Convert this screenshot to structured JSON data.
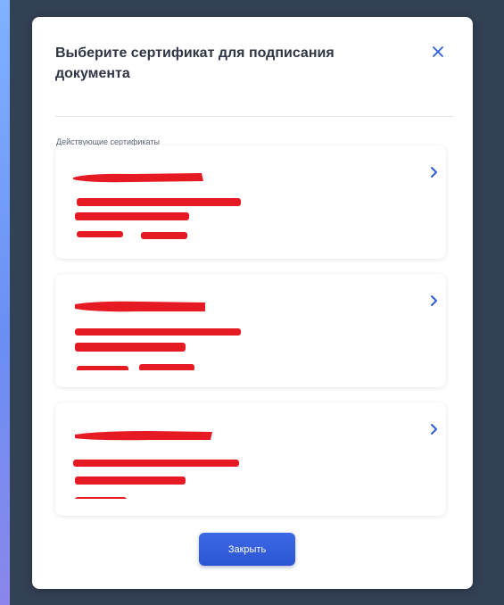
{
  "dialog": {
    "title": "Выберите сертификат для подписания документа",
    "section_label": "Действующие сертификаты",
    "close_button_label": "Закрыть",
    "certificates_redacted": true
  },
  "icons": {
    "close": "close-icon",
    "chevron": "chevron-right-icon"
  },
  "colors": {
    "accent": "#2b55d3",
    "redaction": "#e51a23",
    "backdrop": "#334155"
  }
}
